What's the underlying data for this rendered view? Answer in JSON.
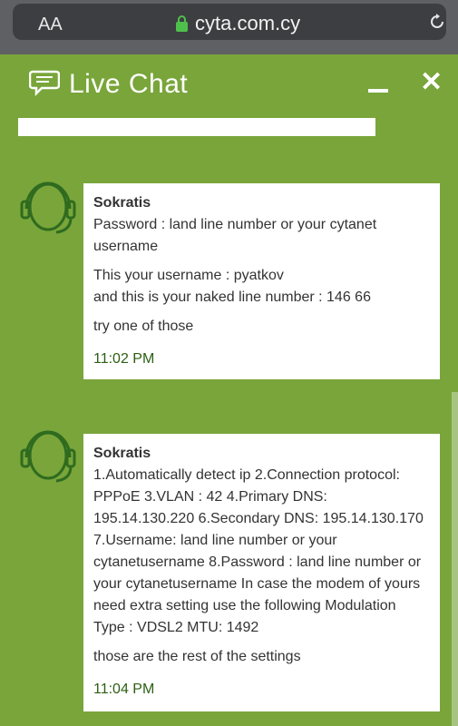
{
  "browser": {
    "text_size_label": "AA",
    "url": "cyta.com.cy"
  },
  "chat": {
    "title": "Live Chat"
  },
  "messages": [
    {
      "sender": "Sokratis",
      "lines": [
        "Password : land line number or your cytanet username",
        "",
        "This your username : pyatkov",
        "and this is your naked line number : 146     66",
        "",
        "try one of those"
      ],
      "time": "11:02 PM"
    },
    {
      "sender": "Sokratis",
      "lines": [
        "1.Automatically detect ip 2.Connection protocol: PPPoE 3.VLAN : 42 4.Primary DNS: 195.14.130.220 6.Secondary DNS: 195.14.130.170 7.Username: land line number or your cytanetusername 8.Password : land line number or your cytanetusername In case the modem of yours need extra setting use the following Modulation Type : VDSL2 MTU: 1492",
        "",
        "those are the rest of the settings"
      ],
      "time": "11:04 PM"
    }
  ],
  "colors": {
    "chat_background": "#79a53a",
    "avatar_green": "#2f6b1f",
    "time_green": "#2c5f12"
  }
}
